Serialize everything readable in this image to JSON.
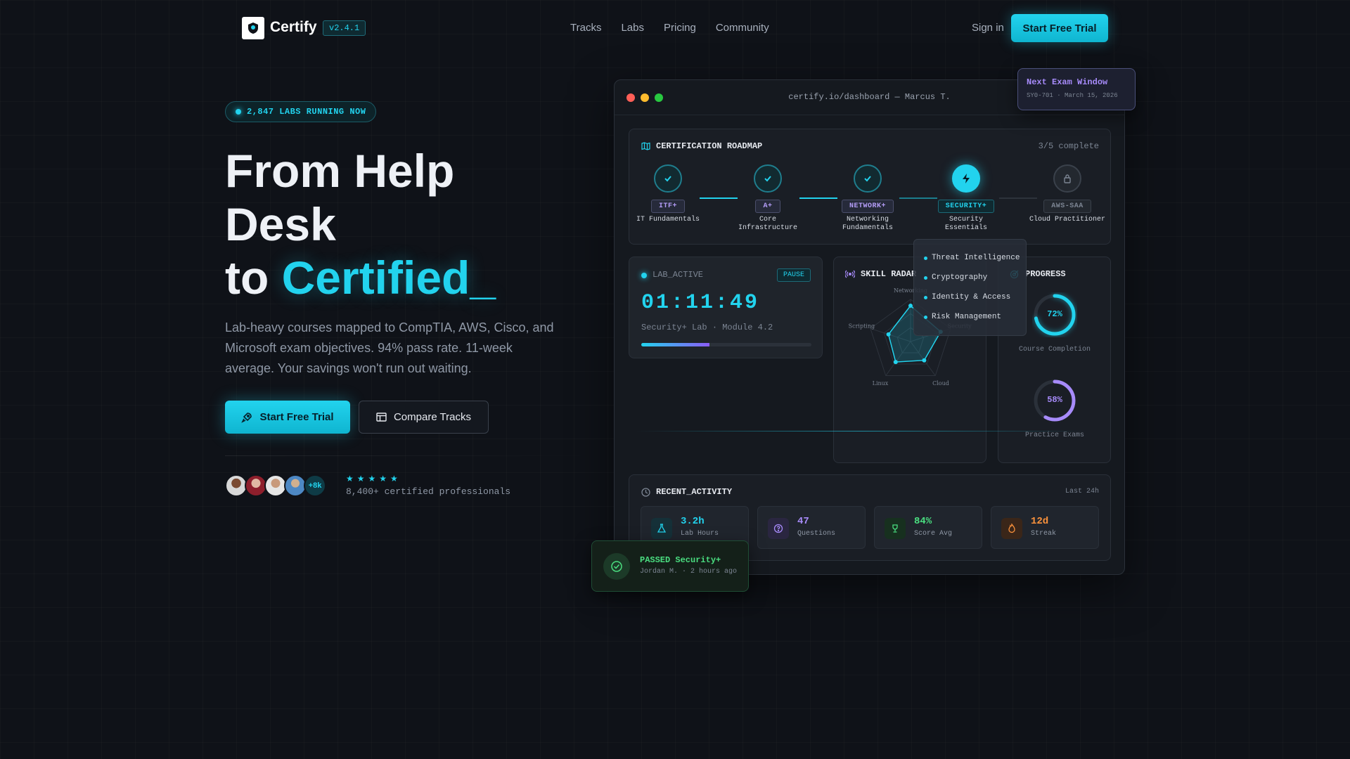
{
  "brand": {
    "name": "Certify",
    "version": "v2.4.1"
  },
  "nav": {
    "links": [
      "Tracks",
      "Labs",
      "Pricing",
      "Community"
    ],
    "signin": "Sign in",
    "cta": "Start Free Trial"
  },
  "hero": {
    "badge": "2,847 LABS RUNNING NOW",
    "headline_line1": "From Help",
    "headline_line2": "Desk",
    "headline_line3_prefix": "to ",
    "headline_accent": "Certified_",
    "subtext": "Lab-heavy courses mapped to CompTIA, AWS, Cisco, and Microsoft exam objectives. 94% pass rate. 11-week average. Your savings won't run out waiting.",
    "primary_cta": "Start Free Trial",
    "secondary_cta": "Compare Tracks",
    "avatar_more": "+8k",
    "stars": "★★★★★",
    "proof": "8,400+ certified professionals"
  },
  "dashboard": {
    "window_title": "certify.io/dashboard — Marcus T.",
    "roadmap": {
      "title": "CERTIFICATION ROADMAP",
      "status": "3/5 complete",
      "steps": [
        {
          "tag": "ITF+",
          "name": "IT Fundamentals",
          "state": "done"
        },
        {
          "tag": "A+",
          "name": "Core Infrastructure",
          "state": "done"
        },
        {
          "tag": "NETWORK+",
          "name": "Networking Fundamentals",
          "state": "done"
        },
        {
          "tag": "SECURITY+",
          "name": "Security Essentials",
          "state": "active"
        },
        {
          "tag": "AWS-SAA",
          "name": "Cloud Practitioner",
          "state": "locked"
        }
      ]
    },
    "lab": {
      "label": "LAB_ACTIVE",
      "pause": "PAUSE",
      "timer": "01:11:49",
      "module": "Security+ Lab · Module 4.2",
      "progress": 0.4
    },
    "radar": {
      "title": "SKILL RADAR",
      "axes": [
        "Networking",
        "Security",
        "Cloud",
        "Linux",
        "Scripting"
      ],
      "values": [
        0.85,
        0.75,
        0.55,
        0.6,
        0.55
      ],
      "tooltip_items": [
        "Threat Intelligence",
        "Cryptography",
        "Identity & Access",
        "Risk Management"
      ]
    },
    "progress": {
      "title": "PROGRESS",
      "course_pct": 72,
      "course_pct_label": "72%",
      "course_label": "Course Completion",
      "practice_pct": 58,
      "practice_pct_label": "58%",
      "practice_label": "Practice Exams"
    },
    "activity": {
      "title": "RECENT_ACTIVITY",
      "range": "Last 24h",
      "stats": [
        {
          "value": "3.2h",
          "label": "Lab Hours",
          "color": "#22d3ee"
        },
        {
          "value": "47",
          "label": "Questions",
          "color": "#a78bfa"
        },
        {
          "value": "84%",
          "label": "Score Avg",
          "color": "#4ade80"
        },
        {
          "value": "12d",
          "label": "Streak",
          "color": "#fb923c"
        }
      ]
    }
  },
  "popups": {
    "exam_title": "Next Exam Window",
    "exam_detail": "SY0-701 · March 15, 2026",
    "passed_title": "PASSED Security+",
    "passed_detail": "Jordan M. · 2 hours ago"
  },
  "colors": {
    "accent": "#22d3ee",
    "purple": "#a78bfa",
    "green": "#4ade80",
    "orange": "#fb923c"
  }
}
